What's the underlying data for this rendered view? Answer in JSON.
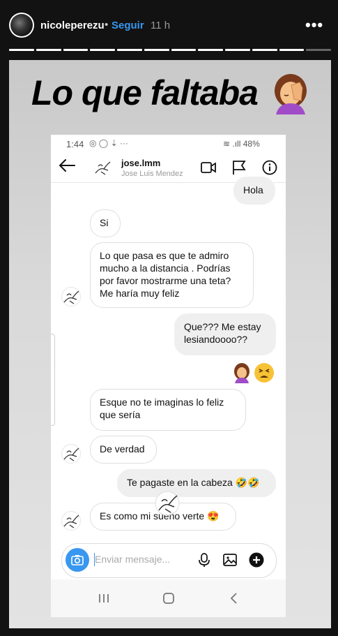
{
  "story": {
    "username": "nicoleperezu",
    "separator": "•",
    "follow_label": "Seguir",
    "time": "11 h",
    "more": "•••",
    "caption": "Lo que faltaba",
    "segments_total": 12,
    "segments_done": 11
  },
  "phone": {
    "status_time": "1:44",
    "status_icons": "◎ ◯ ⇣ ···",
    "status_right": "≋ .ıll 48%",
    "dm_username": "jose.lmm",
    "dm_fullname": "Jose Luis Mendez",
    "messages": [
      {
        "side": "me",
        "text": "Hola"
      },
      {
        "side": "them",
        "text": "Si"
      },
      {
        "side": "them",
        "text": "Lo que pasa es que te admiro mucho a la distancia . Podrías por favor mostrarme una teta? Me haría muy feliz"
      },
      {
        "side": "me",
        "text": "Que??? Me estay lesiandoooo??"
      },
      {
        "side": "them",
        "text": "Esque no te imaginas lo feliz que sería"
      },
      {
        "side": "them",
        "text": "De verdad"
      },
      {
        "side": "me",
        "text": "Te pagaste en la cabeza 🤣🤣"
      },
      {
        "side": "them",
        "text": "Es como mi sueño verte 😍"
      }
    ],
    "composer_placeholder": "Enviar mensaje..."
  }
}
